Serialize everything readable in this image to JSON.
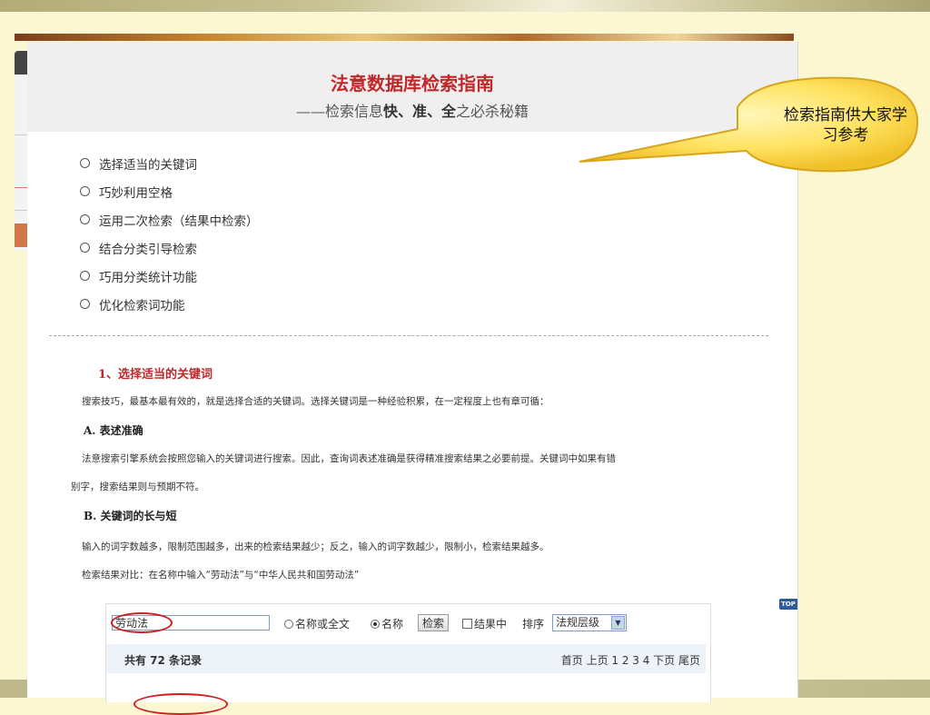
{
  "header": {
    "title": "法意数据库检索指南",
    "subtitle_prefix": "——检索信息",
    "subtitle_bold": "快、准、全",
    "subtitle_suffix": "之必杀秘籍"
  },
  "toc": [
    "选择适当的关键词",
    "巧妙利用空格",
    "运用二次检索（结果中检索）",
    "结合分类引导检索",
    "巧用分类统计功能",
    "优化检索词功能"
  ],
  "section1": {
    "heading": "1、选择适当的关键词",
    "intro": "搜索技巧，最基本最有效的，就是选择合适的关键词。选择关键词是一种经验积累，在一定程度上也有章可循：",
    "sub_a": "A. 表述准确",
    "para_a_line1": "法意搜索引擎系统会按照您输入的关键词进行搜索。因此，查询词表述准确是获得精准搜索结果之必要前提。关键词中如果有错",
    "para_a_line2": "别字，搜索结果则与预期不符。",
    "sub_b": "B. 关键词的长与短",
    "para_b": "输入的词字数越多，限制范围越多，出来的检索结果越少；反之，输入的词字数越少，限制小，检索结果越多。",
    "compare": "检索结果对比：在名称中输入“劳动法”与“中华人民共和国劳动法”"
  },
  "search_example": {
    "input_value": "劳动法",
    "option_fulltext": "名称或全文",
    "option_name": "名称",
    "search_button": "检索",
    "in_results": "结果中",
    "sort_label": "排序",
    "sort_value": "法规层级",
    "result_count": "共有 72 条记录",
    "pager": "首页 上页 1 2 3 4 下页 尾页"
  },
  "callout": {
    "text": "检索指南供大家学习参考"
  },
  "top_badge": "TOP"
}
